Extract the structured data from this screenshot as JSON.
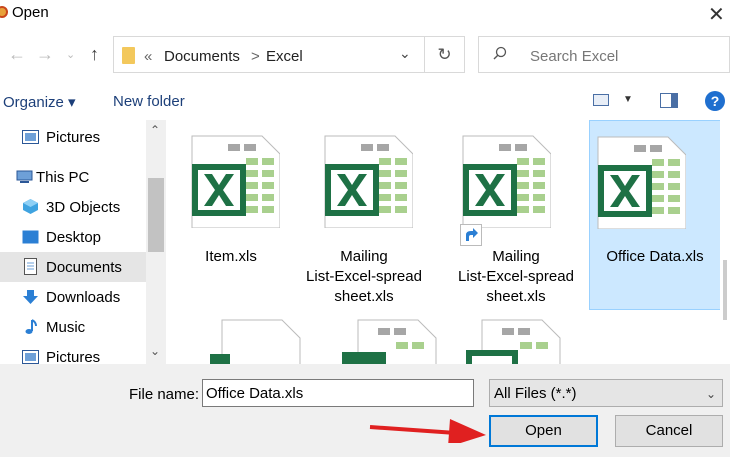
{
  "window": {
    "title": "Open",
    "close_symbol": "✕"
  },
  "address": {
    "prefix": "«",
    "segments": [
      "Documents",
      "Excel"
    ],
    "separator": ">"
  },
  "search": {
    "placeholder": "Search Excel"
  },
  "toolbar": {
    "organize_label": "Organize ▾",
    "new_folder_label": "New folder",
    "help_label": "?"
  },
  "nav_items": [
    {
      "label": "Pictures",
      "icon": "pictures-icon",
      "selected": false
    },
    {
      "label": "This PC",
      "icon": "computer-icon",
      "selected": false
    },
    {
      "label": "3D Objects",
      "icon": "3d-objects-icon",
      "selected": false
    },
    {
      "label": "Desktop",
      "icon": "desktop-icon",
      "selected": false
    },
    {
      "label": "Documents",
      "icon": "documents-icon",
      "selected": true
    },
    {
      "label": "Downloads",
      "icon": "downloads-icon",
      "selected": false
    },
    {
      "label": "Music",
      "icon": "music-icon",
      "selected": false
    },
    {
      "label": "Pictures",
      "icon": "pictures-icon",
      "selected": false
    }
  ],
  "files": [
    {
      "name": "Item.xls",
      "shortcut": false,
      "selected": false
    },
    {
      "name": "Mailing List-Excel-spreadsheet.xls",
      "line1": "Mailing",
      "line2": "List-Excel-spread",
      "line3": "sheet.xls",
      "shortcut": false,
      "selected": false
    },
    {
      "name": "Mailing List-Excel-spreadsheet.xls",
      "line1": "Mailing",
      "line2": "List-Excel-spread",
      "line3": "sheet.xls",
      "shortcut": true,
      "selected": false
    },
    {
      "name": "Office Data.xls",
      "shortcut": false,
      "selected": true
    }
  ],
  "bottom": {
    "file_name_label": "File name:",
    "file_name_value": "Office Data.xls",
    "file_type_value": "All Files (*.*)",
    "open_label": "Open",
    "cancel_label": "Cancel"
  },
  "colors": {
    "excel_green": "#1e7145",
    "sheet_gray": "#a6a6a6",
    "cell_green": "#a9d08e",
    "accent": "#0078d7",
    "annotation_arrow": "#e02020"
  }
}
